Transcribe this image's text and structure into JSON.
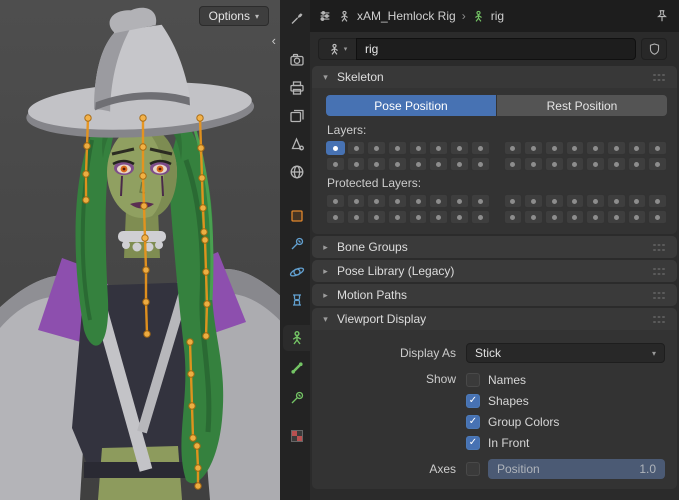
{
  "viewport": {
    "options_label": "Options"
  },
  "icons": {
    "chevron_down": "▾",
    "chevron_right": "▸",
    "breadcrumb_sep": "›",
    "collapse_left": "‹"
  },
  "tab_strip": [
    "tool",
    "render",
    "output",
    "view-layer",
    "scene",
    "world",
    "object",
    "modifiers",
    "physics",
    "constraints",
    "object-data",
    "bone",
    "bone-constraint",
    "texture"
  ],
  "tab_selected": "object-data",
  "header": {
    "object_name": "xAM_Hemlock Rig",
    "data_name": "rig"
  },
  "datablock": {
    "name": "rig"
  },
  "panels": {
    "skeleton": {
      "title": "Skeleton",
      "pose_position": "Pose Position",
      "rest_position": "Rest Position",
      "layers_label": "Layers:",
      "protected_label": "Protected Layers:",
      "layers": {
        "groups": 2,
        "rows": 2,
        "cols": 8,
        "enabled": [
          "0-0-0"
        ]
      },
      "protected_layers": {
        "groups": 2,
        "rows": 2,
        "cols": 8,
        "enabled": []
      }
    },
    "bone_groups": {
      "title": "Bone Groups"
    },
    "pose_library": {
      "title": "Pose Library (Legacy)"
    },
    "motion_paths": {
      "title": "Motion Paths"
    },
    "viewport_display": {
      "title": "Viewport Display",
      "display_as_label": "Display As",
      "display_as_value": "Stick",
      "show_label": "Show",
      "checkboxes": [
        {
          "label": "Names",
          "checked": false
        },
        {
          "label": "Shapes",
          "checked": true
        },
        {
          "label": "Group Colors",
          "checked": true
        },
        {
          "label": "In Front",
          "checked": true
        }
      ],
      "axes_label": "Axes",
      "position_label": "Position",
      "position_value": "1.0"
    }
  },
  "colors": {
    "accent_blue": "#4772b3",
    "bone_orange": "#e8941c",
    "hair_green": "#35813e",
    "skin_green": "#90a061",
    "collar_purple": "#b06ac6"
  }
}
